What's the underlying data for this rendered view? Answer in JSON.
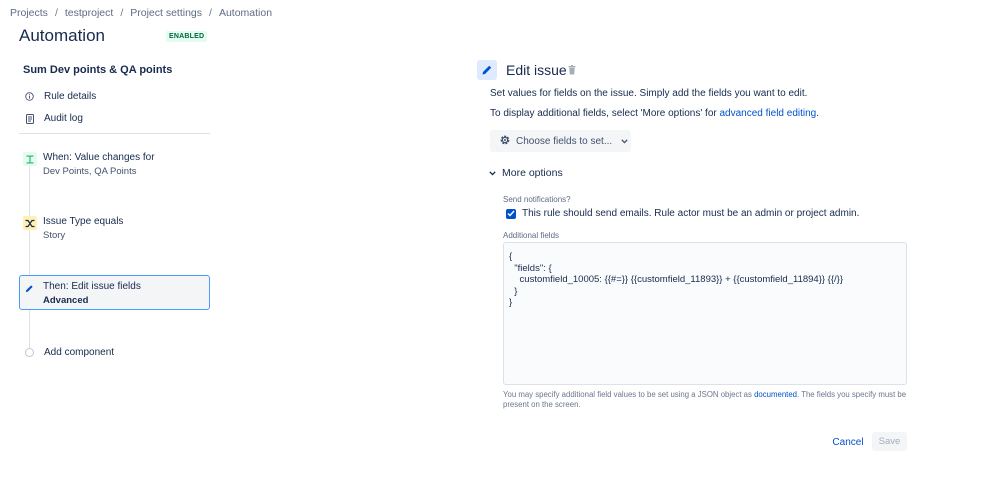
{
  "breadcrumb": {
    "items": [
      "Projects",
      "testproject",
      "Project settings",
      "Automation"
    ],
    "separator": "/"
  },
  "header": {
    "title": "Automation",
    "status": "ENABLED"
  },
  "sidebar": {
    "rule_name": "Sum Dev points & QA points",
    "links": [
      {
        "label": "Rule details",
        "icon": "info-icon"
      },
      {
        "label": "Audit log",
        "icon": "document-icon"
      }
    ],
    "steps": [
      {
        "title": "When: Value changes for",
        "subtitle": "Dev Points, QA Points",
        "icon": "trigger-icon",
        "color": "#36b37e"
      },
      {
        "title": "Issue Type equals",
        "subtitle": "Story",
        "icon": "condition-icon",
        "color": "#ffab00"
      },
      {
        "title": "Then: Edit issue fields",
        "subtitle": "Advanced",
        "icon": "pencil-icon",
        "color": "#0052cc"
      }
    ],
    "add_component": "Add component"
  },
  "panel": {
    "title": "Edit issue",
    "description1": "Set values for fields on the issue. Simply add the fields you want to edit.",
    "description2_prefix": "To display additional fields, select 'More options' for ",
    "description2_link": "advanced field editing",
    "description2_suffix": ".",
    "choose_fields_button": "Choose fields to set...",
    "more_options_label": "More options",
    "send_notifications_label": "Send notifications?",
    "checkbox_label": "This rule should send emails. Rule actor must be an admin or project admin.",
    "checkbox_checked": true,
    "additional_fields_label": "Additional fields",
    "additional_fields_value": "{\n  \"fields\": {\n    customfield_10005: {{#=}} {{customfield_11893}} + {{customfield_11894}} {{/}}\n  }\n}",
    "help_prefix": "You may specify additional field values to be set using a JSON object as ",
    "help_link": "documented",
    "help_suffix": ". The fields you specify must be present on the screen.",
    "cancel_label": "Cancel",
    "save_label": "Save"
  },
  "colors": {
    "accent": "#0052cc",
    "enabled_bg": "#e3fcef",
    "enabled_text": "#006644",
    "selected_border": "#4c9aff"
  }
}
